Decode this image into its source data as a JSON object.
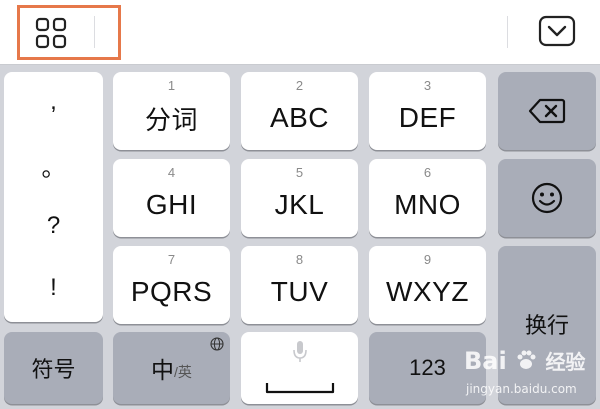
{
  "toolbar": {
    "menu_icon": "grid-icon",
    "hide_icon": "keyboard-hide-chevron-icon"
  },
  "symbols": [
    ",",
    "。",
    "?",
    "!"
  ],
  "keys": [
    {
      "num": "1",
      "label": "分词"
    },
    {
      "num": "2",
      "label": "ABC"
    },
    {
      "num": "3",
      "label": "DEF"
    },
    {
      "num": "4",
      "label": "GHI"
    },
    {
      "num": "5",
      "label": "JKL"
    },
    {
      "num": "6",
      "label": "MNO"
    },
    {
      "num": "7",
      "label": "PQRS"
    },
    {
      "num": "8",
      "label": "TUV"
    },
    {
      "num": "9",
      "label": "WXYZ"
    }
  ],
  "function_keys": {
    "backspace_icon": "backspace-icon",
    "emoji_icon": "emoji-icon",
    "enter_label": "换行",
    "symbols_label": "符号",
    "lang_main": "中",
    "lang_sub": "/英",
    "globe_icon": "globe-icon",
    "mic_icon": "microphone-icon",
    "numbers_label": "123"
  },
  "watermark": {
    "brand": "Bai",
    "brand_cn": "经验",
    "url": "jingyan.baidu.com"
  },
  "colors": {
    "highlight": "#e6784a",
    "function_key": "#a9adb8",
    "keyboard_bg": "#d2d4da"
  }
}
